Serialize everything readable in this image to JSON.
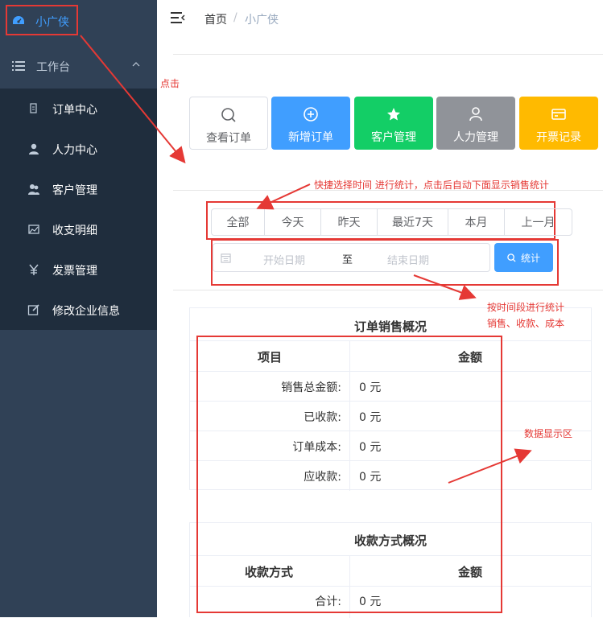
{
  "sidebar": {
    "brand_label": "小广侠",
    "workbench_label": "工作台",
    "items": [
      {
        "label": "订单中心",
        "icon": "order-icon"
      },
      {
        "label": "人力中心",
        "icon": "person-icon"
      },
      {
        "label": "客户管理",
        "icon": "customers-icon"
      },
      {
        "label": "收支明细",
        "icon": "ledger-icon"
      },
      {
        "label": "发票管理",
        "icon": "yen-icon"
      },
      {
        "label": "修改企业信息",
        "icon": "edit-icon"
      }
    ]
  },
  "breadcrumb": {
    "home": "首页",
    "separator": "/",
    "current": "小广侠"
  },
  "quick_actions": [
    {
      "label": "查看订单",
      "icon": "search-icon",
      "color": "#ffffff"
    },
    {
      "label": "新增订单",
      "icon": "plus-circle-icon",
      "color": "#409eff"
    },
    {
      "label": "客户管理",
      "icon": "star-icon",
      "color": "#13ce66"
    },
    {
      "label": "人力管理",
      "icon": "user-icon",
      "color": "#909399"
    },
    {
      "label": "开票记录",
      "icon": "card-icon",
      "color": "#ffba00"
    }
  ],
  "annotations": {
    "click": "点击",
    "quick_time": "快捷选择时间 进行统计，点击后自动下面显示销售统计",
    "by_period_line1": "按时间段进行统计",
    "by_period_line2": "销售、收款、成本",
    "data_area": "数据显示区"
  },
  "time_ranges": [
    "全部",
    "今天",
    "昨天",
    "最近7天",
    "本月",
    "上一月"
  ],
  "date_range": {
    "start_placeholder": "开始日期",
    "separator": "至",
    "end_placeholder": "结束日期"
  },
  "stat_button": "统计",
  "sales_table": {
    "title": "订单销售概况",
    "col_item": "项目",
    "col_amount": "金额",
    "rows": [
      {
        "item": "销售总金额:",
        "amount": "0 元"
      },
      {
        "item": "已收款:",
        "amount": "0 元"
      },
      {
        "item": "订单成本:",
        "amount": "0 元"
      },
      {
        "item": "应收款:",
        "amount": "0 元"
      }
    ]
  },
  "payment_table": {
    "title": "收款方式概况",
    "col_method": "收款方式",
    "col_amount": "金额",
    "rows": [
      {
        "item": "合计:",
        "amount": "0 元"
      }
    ]
  },
  "colors": {
    "accent": "#409eff",
    "annotation": "#e53935",
    "sidebar": "#304156",
    "submenu": "#1f2d3d"
  }
}
